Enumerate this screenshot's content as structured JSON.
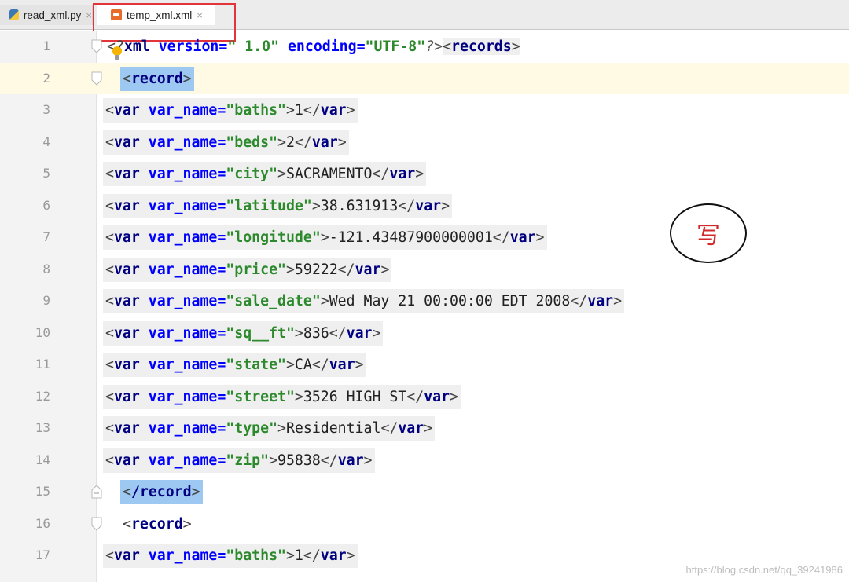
{
  "tabs": [
    {
      "label": "read_xml.py",
      "icon": "python-file-icon",
      "active": false
    },
    {
      "label": "temp_xml.xml",
      "icon": "xml-file-icon",
      "active": true
    }
  ],
  "annotation": "写",
  "watermark": "https://blog.csdn.net/qq_39241986",
  "colors": {
    "tag": "#000080",
    "attr": "#0000ff",
    "value": "#2c8a2c",
    "highlight_box": "#e3343b",
    "matched_tag": "#9dc8f2"
  },
  "lines": [
    {
      "num": "1",
      "xml_decl": {
        "open": "<?",
        "name": "xml",
        "a1": " version=",
        "v1": "\" 1.0\"",
        "a2": " encoding=",
        "v2": "\"UTF-8\"",
        "close": "?>"
      },
      "root": "records"
    },
    {
      "num": "2",
      "tag": "record"
    },
    {
      "num": "3",
      "name": "baths",
      "value": "1"
    },
    {
      "num": "4",
      "name": "beds",
      "value": "2"
    },
    {
      "num": "5",
      "name": "city",
      "value": "SACRAMENTO"
    },
    {
      "num": "6",
      "name": "latitude",
      "value": "38.631913"
    },
    {
      "num": "7",
      "name": "longitude",
      "value": "-121.43487900000001"
    },
    {
      "num": "8",
      "name": "price",
      "value": "59222"
    },
    {
      "num": "9",
      "name": "sale_date",
      "value": "Wed May 21 00:00:00 EDT 2008"
    },
    {
      "num": "10",
      "name": "sq__ft",
      "value": "836"
    },
    {
      "num": "11",
      "name": "state",
      "value": "CA"
    },
    {
      "num": "12",
      "name": "street",
      "value": "3526 HIGH ST"
    },
    {
      "num": "13",
      "name": "type",
      "value": "Residential"
    },
    {
      "num": "14",
      "name": "zip",
      "value": "95838"
    },
    {
      "num": "15",
      "tag": "/record"
    },
    {
      "num": "16",
      "tag": "record"
    },
    {
      "num": "17",
      "name": "baths",
      "value": "1"
    }
  ]
}
